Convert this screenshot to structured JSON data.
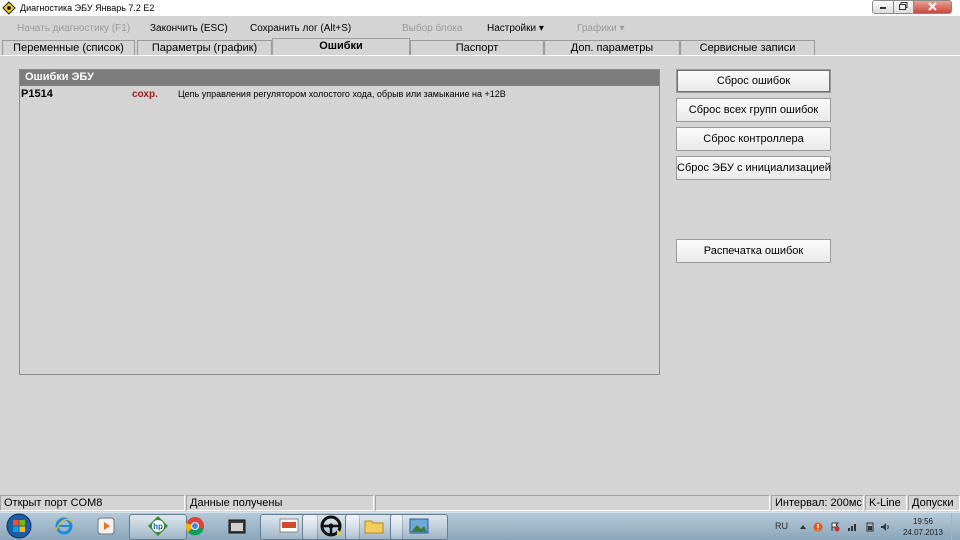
{
  "window": {
    "title": "Диагностика ЭБУ Январь 7.2 Е2",
    "controls": {
      "minimize_icon": "minimize-icon",
      "maximize_icon": "restore-icon",
      "close_icon": "close-icon"
    }
  },
  "menu": {
    "start_diag": "Начать диагностику (F1)",
    "stop": "Закончить (ESC)",
    "save_log": "Сохранить лог (Alt+S)",
    "select_block": "Выбор блока",
    "settings": "Настройки",
    "charts": "Графики"
  },
  "tabs": [
    {
      "label": "Переменные (список)",
      "active": false
    },
    {
      "label": "Параметры (график)",
      "active": false
    },
    {
      "label": "Ошибки",
      "active": true
    },
    {
      "label": "Паспорт",
      "active": false
    },
    {
      "label": "Доп. параметры",
      "active": false
    },
    {
      "label": "Сервисные записи",
      "active": false
    }
  ],
  "errors_panel": {
    "title": "Ошибки ЭБУ",
    "rows": [
      {
        "code": "P1514",
        "status": "сохр.",
        "description": "Цепь управления регулятором холостого хода, обрыв или замыкание на +12В"
      }
    ]
  },
  "actions": {
    "reset_errors": "Сброс ошибок",
    "reset_all_groups": "Сброс всех групп ошибок",
    "reset_controller": "Сброс контроллера",
    "reset_ecu_init": "Сброс ЭБУ с инициализацией",
    "print_errors": "Распечатка ошибок"
  },
  "statusbar": {
    "port": "Открыт порт COM8",
    "data": "Данные получены",
    "interval": "Интервал: 200мс",
    "protocol": "K-Line",
    "tolerances": "Допуски"
  },
  "taskbar": {
    "language": "RU",
    "time": "19:56",
    "date": "24.07.2013",
    "apps": [
      "start-orb-icon",
      "internet-explorer-icon",
      "media-player-icon",
      "hp-icon",
      "chrome-icon",
      "app-window-icon",
      "presentation-icon",
      "steering-wheel-icon",
      "file-explorer-icon",
      "photo-viewer-icon"
    ]
  },
  "colors": {
    "panel_header": "#7c7c7c",
    "error_status": "#a31a1a",
    "window_bg": "#d4d4d4"
  }
}
